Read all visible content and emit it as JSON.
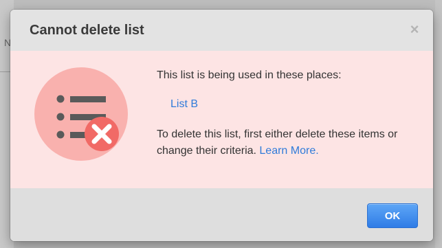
{
  "backdrop": {
    "partial_text": "N"
  },
  "dialog": {
    "title": "Cannot delete list",
    "close_glyph": "×",
    "intro": "This list is being used in these places:",
    "usages": [
      {
        "label": "List B"
      }
    ],
    "instructions_text": "To delete this list, first either delete these items or change their criteria. ",
    "learn_more_label": "Learn More.",
    "ok_label": "OK"
  },
  "colors": {
    "body_bg": "#fde4e4",
    "link": "#2f7bd9",
    "icon_circle": "#f9b1ae",
    "error_badge": "#f16a66",
    "ok_button": "#3a86ec"
  },
  "icons": {
    "illustration": "list-with-error-icon",
    "close": "close-icon"
  }
}
